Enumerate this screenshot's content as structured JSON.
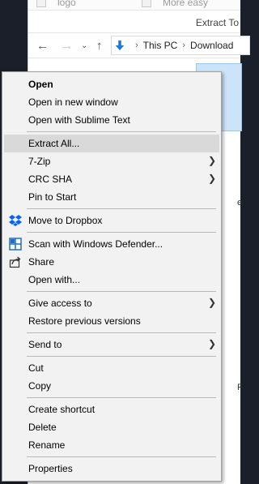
{
  "explorer": {
    "files": [
      "logo",
      "More easy"
    ],
    "ribbon_tab": "Extract To",
    "breadcrumb": [
      "This PC",
      "Download"
    ],
    "stray_texts": [
      "e",
      "F"
    ]
  },
  "menu": {
    "items": [
      {
        "label": "Open"
      },
      {
        "label": "Open in new window"
      },
      {
        "label": "Open with Sublime Text"
      },
      {
        "label": "Extract All..."
      },
      {
        "label": "7-Zip"
      },
      {
        "label": "CRC SHA"
      },
      {
        "label": "Pin to Start"
      },
      {
        "label": "Move to Dropbox"
      },
      {
        "label": "Scan with Windows Defender..."
      },
      {
        "label": "Share"
      },
      {
        "label": "Open with..."
      },
      {
        "label": "Give access to"
      },
      {
        "label": "Restore previous versions"
      },
      {
        "label": "Send to"
      },
      {
        "label": "Cut"
      },
      {
        "label": "Copy"
      },
      {
        "label": "Create shortcut"
      },
      {
        "label": "Delete"
      },
      {
        "label": "Rename"
      },
      {
        "label": "Properties"
      }
    ]
  },
  "colors": {
    "highlight": "#d9d9d9",
    "dropbox_blue": "#0061fe",
    "defender_blue": "#1e6fc4",
    "download_blue": "#1f78d1"
  }
}
